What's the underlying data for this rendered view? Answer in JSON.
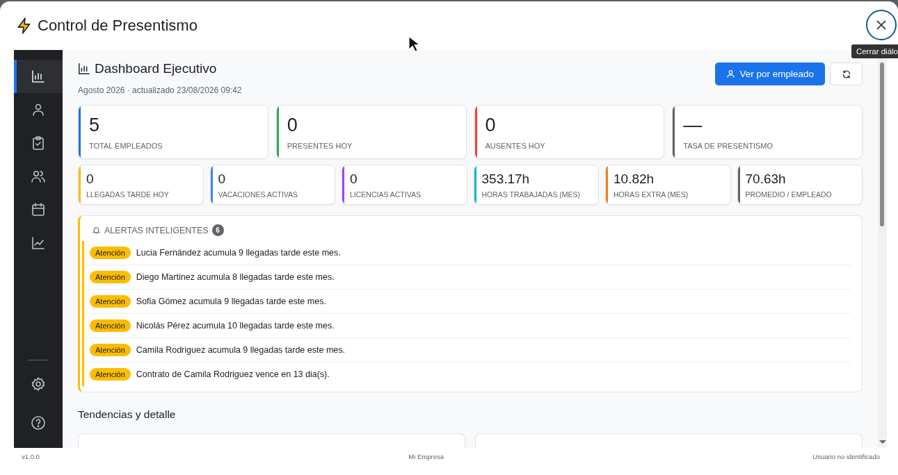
{
  "window": {
    "title": "Control de Presentismo",
    "close_tooltip": "Cerrar diálo"
  },
  "sidebar": {
    "items": [
      {
        "kind": "chart",
        "selected": true
      },
      {
        "kind": "person",
        "selected": false
      },
      {
        "kind": "clipboard",
        "selected": false
      },
      {
        "kind": "people",
        "selected": false
      },
      {
        "kind": "calendar",
        "selected": false
      },
      {
        "kind": "trend",
        "selected": false
      }
    ],
    "bottom_items": [
      {
        "kind": "settings"
      },
      {
        "kind": "help"
      }
    ]
  },
  "header": {
    "title": "Dashboard Ejecutivo",
    "subtitle": "Agosto 2026 · actualizado 23/08/2026 09:42",
    "primary_button": "Ver por empleado"
  },
  "stats_main": [
    {
      "value": "5",
      "label": "TOTAL EMPLEADOS",
      "color": "#1a73e8"
    },
    {
      "value": "0",
      "label": "PRESENTES HOY",
      "color": "#34a853"
    },
    {
      "value": "0",
      "label": "AUSENTES HOY",
      "color": "#ea4335"
    },
    {
      "value": "—",
      "label": "TASA DE PRESENTISMO",
      "color": "#5f6368"
    }
  ],
  "stats_secondary": [
    {
      "value": "0",
      "label": "LLEGADAS TARDE HOY",
      "color": "#fbbc04"
    },
    {
      "value": "0",
      "label": "VACACIONES ACTIVAS",
      "color": "#4285f4"
    },
    {
      "value": "0",
      "label": "LICENCIAS ACTIVAS",
      "color": "#a142f4"
    },
    {
      "value": "353.17h",
      "label": "HORAS TRABAJADAS (MES)",
      "color": "#12b5cb"
    },
    {
      "value": "10.82h",
      "label": "HORAS EXTRA (MES)",
      "color": "#fa7b17"
    },
    {
      "value": "70.63h",
      "label": "PROMEDIO / EMPLEADO",
      "color": "#5f6368"
    }
  ],
  "alerts": {
    "title": "ALERTAS INTELIGENTES",
    "count": "6",
    "items": [
      {
        "badge": "Atención",
        "text": "Lucia Fernández acumula 9 llegadas tarde este mes."
      },
      {
        "badge": "Atención",
        "text": "Diego Martinez acumula 8 llegadas tarde este mes."
      },
      {
        "badge": "Atención",
        "text": "Sofia Gómez acumula 9 llegadas tarde este mes."
      },
      {
        "badge": "Atención",
        "text": "Nicolás Pérez acumula 10 llegadas tarde este mes."
      },
      {
        "badge": "Atención",
        "text": "Camila Rodriguez acumula 9 llegadas tarde este mes."
      },
      {
        "badge": "Atención",
        "text": "Contrato de Camila Rodriguez vence en 13 dia(s)."
      }
    ]
  },
  "section_title": "Tendencias y detalle",
  "status_bar": {
    "version": "v1.0.0",
    "company": "Mi Empresa",
    "user": "Usuario no identificado"
  }
}
